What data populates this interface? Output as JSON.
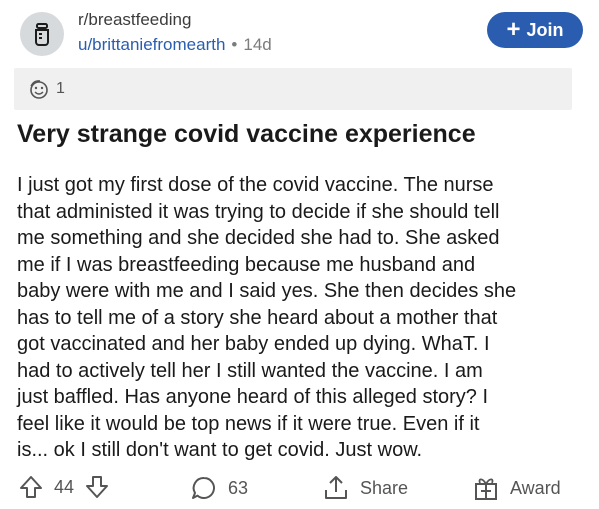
{
  "header": {
    "subreddit": "r/breastfeeding",
    "username": "u/brittaniefromearth",
    "separator": "•",
    "age": "14d",
    "join_label": "Join"
  },
  "award_bar": {
    "icon": "award-face-icon",
    "count": "1"
  },
  "post": {
    "title": "Very strange covid vaccine experience",
    "body": "I just got my first dose of the covid vaccine.  The nurse\nthat administed it was trying to decide if she should tell\nme something and she decided she had to.  She asked\nme if I was breastfeeding because me husband and\nbaby were with me and I said yes. She then decides she\nhas to tell me of a story she heard about a mother that\ngot vaccinated and her baby ended up dying.  WhaT. I\nhad to actively tell her I still wanted the vaccine.  I am\njust baffled. Has anyone heard of this alleged story?  I\nfeel like it would be top news if it were true.  Even if it\nis... ok I still don't want to get covid.  Just wow."
  },
  "actions": {
    "score": "44",
    "comments": "63",
    "share_label": "Share",
    "award_label": "Award"
  },
  "colors": {
    "accent": "#2a5db0",
    "muted": "#7c7c7c",
    "bar_bg": "#f0f0f0"
  }
}
